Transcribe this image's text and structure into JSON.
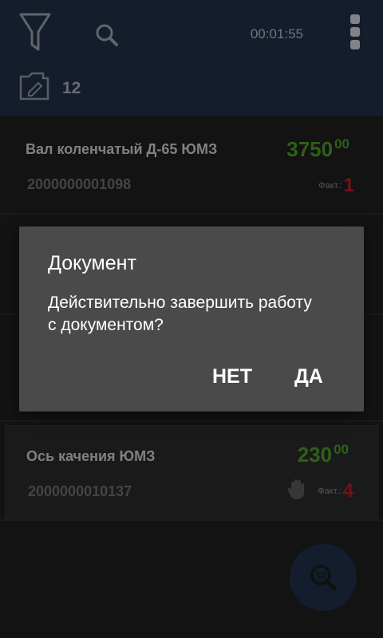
{
  "header": {
    "timer": "00:01:55",
    "doc_count": "12",
    "filter_icon": "filter-icon",
    "search_icon": "search-icon",
    "menu_icon": "more-vertical-icon"
  },
  "items": [
    {
      "name": "Вал коленчатый Д-65 ЮМЗ",
      "code": "2000000001098",
      "price_main": "3750",
      "price_cents": "00",
      "fact_label": "Факт.:",
      "fact_value": "1"
    },
    {
      "name": "Ось качения ЮМЗ",
      "code": "2000000010137",
      "price_main": "230",
      "price_cents": "00",
      "fact_label": "Факт.:",
      "fact_value": "4"
    }
  ],
  "dialog": {
    "title": "Документ",
    "message": "Действительно завершить работу с документом?",
    "no_label": "НЕТ",
    "yes_label": "ДА"
  },
  "colors": {
    "header_bg": "#223047",
    "price_green": "#4b9c28",
    "fact_red": "#b8202c",
    "dialog_bg": "#4a4a4a"
  }
}
